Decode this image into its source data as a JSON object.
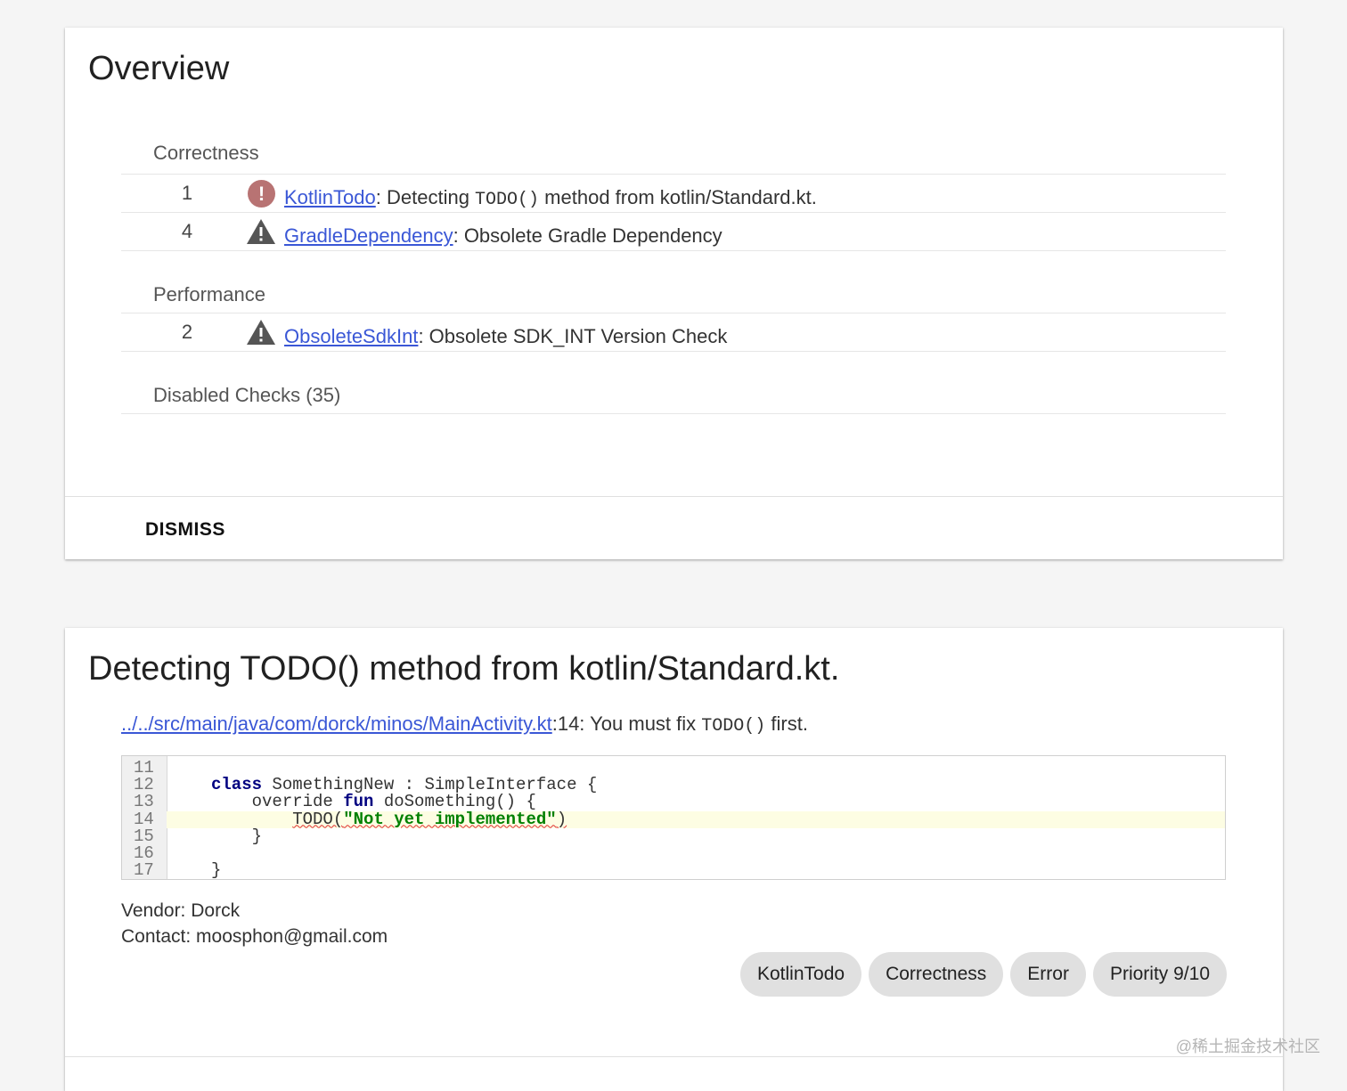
{
  "overview": {
    "title": "Overview",
    "categories": [
      {
        "name": "Correctness",
        "issues": [
          {
            "count": "1",
            "severity_icon": "error-icon",
            "id": "KotlinTodo",
            "sep": ": ",
            "text_before": "Detecting ",
            "code": "TODO()",
            "text_after": " method from kotlin/Standard.kt."
          },
          {
            "count": "4",
            "severity_icon": "warning-icon",
            "id": "GradleDependency",
            "sep": ": ",
            "text": "Obsolete Gradle Dependency"
          }
        ]
      },
      {
        "name": "Performance",
        "issues": [
          {
            "count": "2",
            "severity_icon": "warning-icon",
            "id": "ObsoleteSdkInt",
            "sep": ": ",
            "text": "Obsolete SDK_INT Version Check"
          }
        ]
      }
    ],
    "disabled_checks": "Disabled Checks (35)",
    "dismiss_label": "DISMISS"
  },
  "detail": {
    "title": "Detecting TODO() method from kotlin/Standard.kt.",
    "file_link": "../../src/main/java/com/dorck/minos/MainActivity.kt",
    "file_suffix_before": ":14: You must fix ",
    "file_code": "TODO()",
    "file_suffix_after": " first.",
    "code_lines": [
      {
        "num": "11",
        "indent": "",
        "parts": []
      },
      {
        "num": "12",
        "indent": "",
        "parts": [
          {
            "t": "class",
            "c": "kw"
          },
          {
            "t": " SomethingNew : SimpleInterface {",
            "c": ""
          }
        ]
      },
      {
        "num": "13",
        "indent": "    ",
        "parts": [
          {
            "t": "override ",
            "c": ""
          },
          {
            "t": "fun",
            "c": "kw"
          },
          {
            "t": " doSomething() {",
            "c": ""
          }
        ]
      },
      {
        "num": "14",
        "indent": "        ",
        "parts": [
          {
            "t": "TODO(",
            "c": "squiggle"
          },
          {
            "t": "\"Not yet implemented\"",
            "c": "str squiggle"
          },
          {
            "t": ")",
            "c": "squiggle"
          }
        ],
        "highlight": true
      },
      {
        "num": "15",
        "indent": "    ",
        "parts": [
          {
            "t": "}",
            "c": ""
          }
        ]
      },
      {
        "num": "16",
        "indent": "",
        "parts": []
      },
      {
        "num": "17",
        "indent": "",
        "parts": [
          {
            "t": "}",
            "c": ""
          }
        ]
      }
    ],
    "vendor": "Vendor: Dorck",
    "contact": "Contact: moosphon@gmail.com",
    "chips": [
      "KotlinTodo",
      "Correctness",
      "Error",
      "Priority 9/10"
    ]
  },
  "watermark": "@稀土掘金技术社区",
  "colors": {
    "link": "#3a57d6",
    "error_icon": "#b87373",
    "warning_icon": "#555555",
    "highlight_line": "#fdfde3"
  }
}
